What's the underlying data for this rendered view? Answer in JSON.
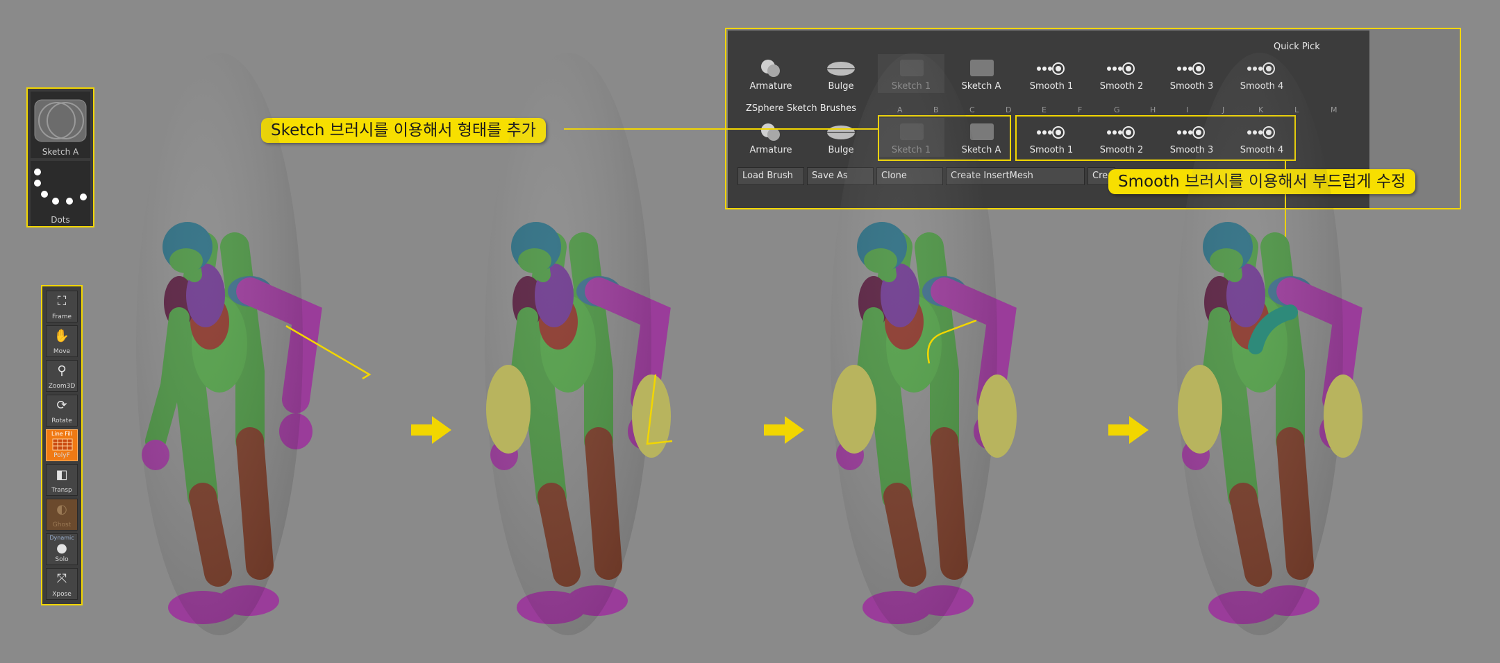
{
  "brush_preview": {
    "items": [
      {
        "label": "Sketch A",
        "icon": "sketch-brush-icon"
      },
      {
        "label": "Dots",
        "icon": "dots-stroke-icon"
      }
    ]
  },
  "toolbar": {
    "items": [
      {
        "label": "Frame",
        "icon": "frame-icon"
      },
      {
        "label": "Move",
        "icon": "hand-move-icon"
      },
      {
        "label": "Zoom3D",
        "icon": "zoom-icon"
      },
      {
        "label": "Rotate",
        "icon": "rotate-icon"
      },
      {
        "label": "PolyF",
        "sublabel": "Line Fill",
        "icon": "polyframe-icon",
        "active": true
      },
      {
        "label": "Transp",
        "icon": "transparency-icon"
      },
      {
        "label": "Ghost",
        "icon": "ghost-icon",
        "disabled": true
      },
      {
        "label": "Solo",
        "sublabel": "Dynamic",
        "icon": "solo-icon"
      },
      {
        "label": "Xpose",
        "icon": "xpose-icon"
      }
    ]
  },
  "palette": {
    "quick_pick_title": "Quick Pick",
    "section_title": "ZSphere Sketch Brushes",
    "letters": [
      "A",
      "B",
      "C",
      "D",
      "E",
      "F",
      "G",
      "H",
      "I",
      "J",
      "K",
      "L",
      "M"
    ],
    "quick_row": [
      {
        "label": "Armature"
      },
      {
        "label": "Bulge"
      },
      {
        "label": "Sketch 1",
        "disabled": true
      },
      {
        "label": "Sketch A"
      },
      {
        "label": "Smooth 1"
      },
      {
        "label": "Smooth 2"
      },
      {
        "label": "Smooth 3"
      },
      {
        "label": "Smooth 4"
      }
    ],
    "sketch_row": [
      {
        "label": "Armature"
      },
      {
        "label": "Bulge"
      },
      {
        "label": "Sketch 1",
        "disabled": true
      },
      {
        "label": "Sketch A"
      },
      {
        "label": "Smooth 1"
      },
      {
        "label": "Smooth 2"
      },
      {
        "label": "Smooth 3"
      },
      {
        "label": "Smooth 4"
      }
    ],
    "buttons": [
      "Load Brush",
      "Save As",
      "Clone",
      "Create InsertMesh",
      "Crea"
    ]
  },
  "callouts": {
    "sketch": "Sketch 브러시를 이용해서 형태를 추가",
    "smooth": "Smooth 브러시를 이용해서 부드럽게 수정"
  },
  "colors": {
    "highlight": "#f2d600",
    "background": "#8a8a8a",
    "panel": "#3c3c3c",
    "green": "#4f9a44",
    "purple": "#9a3c9a",
    "olive": "#b8b45e",
    "brown": "#7a3e2c",
    "teal": "#2e7a82"
  }
}
